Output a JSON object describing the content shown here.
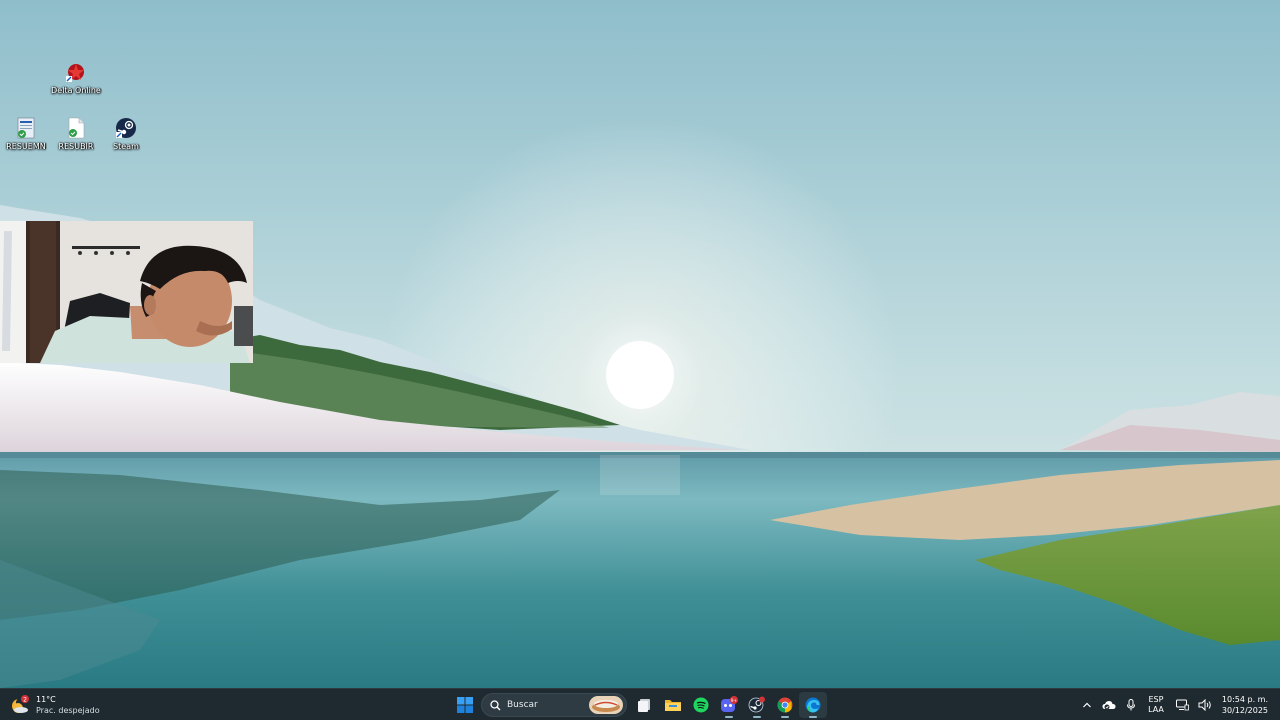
{
  "desktop": {
    "icons": [
      {
        "label": "Delta Online",
        "icon": "delta-online-icon"
      },
      {
        "label": "RESUEMN",
        "icon": "document-shortcut-icon"
      },
      {
        "label": "RESUBIR",
        "icon": "file-shortcut-icon"
      },
      {
        "label": "Steam",
        "icon": "steam-icon"
      }
    ]
  },
  "taskbar": {
    "weather": {
      "temperature": "11°C",
      "condition": "Prac. despejado",
      "badge": "2"
    },
    "search": {
      "placeholder": "Buscar"
    },
    "pinned": [
      {
        "name": "Start",
        "icon": "windows-start-icon"
      },
      {
        "name": "Task View",
        "icon": "task-view-icon"
      },
      {
        "name": "File Explorer",
        "icon": "folder-icon"
      },
      {
        "name": "Spotify",
        "icon": "spotify-icon"
      },
      {
        "name": "Discord",
        "icon": "discord-icon",
        "badge": "9+"
      },
      {
        "name": "Steam",
        "icon": "steam-icon"
      },
      {
        "name": "Chrome",
        "icon": "chrome-icon"
      },
      {
        "name": "Edge",
        "icon": "edge-icon"
      }
    ],
    "tray": {
      "language_top": "ESP",
      "language_bottom": "LAA",
      "time": "10:54 p. m.",
      "date": "30/12/2025"
    }
  },
  "colors": {
    "taskbar_bg": "#1f2a30",
    "accent": "#0078d4"
  }
}
